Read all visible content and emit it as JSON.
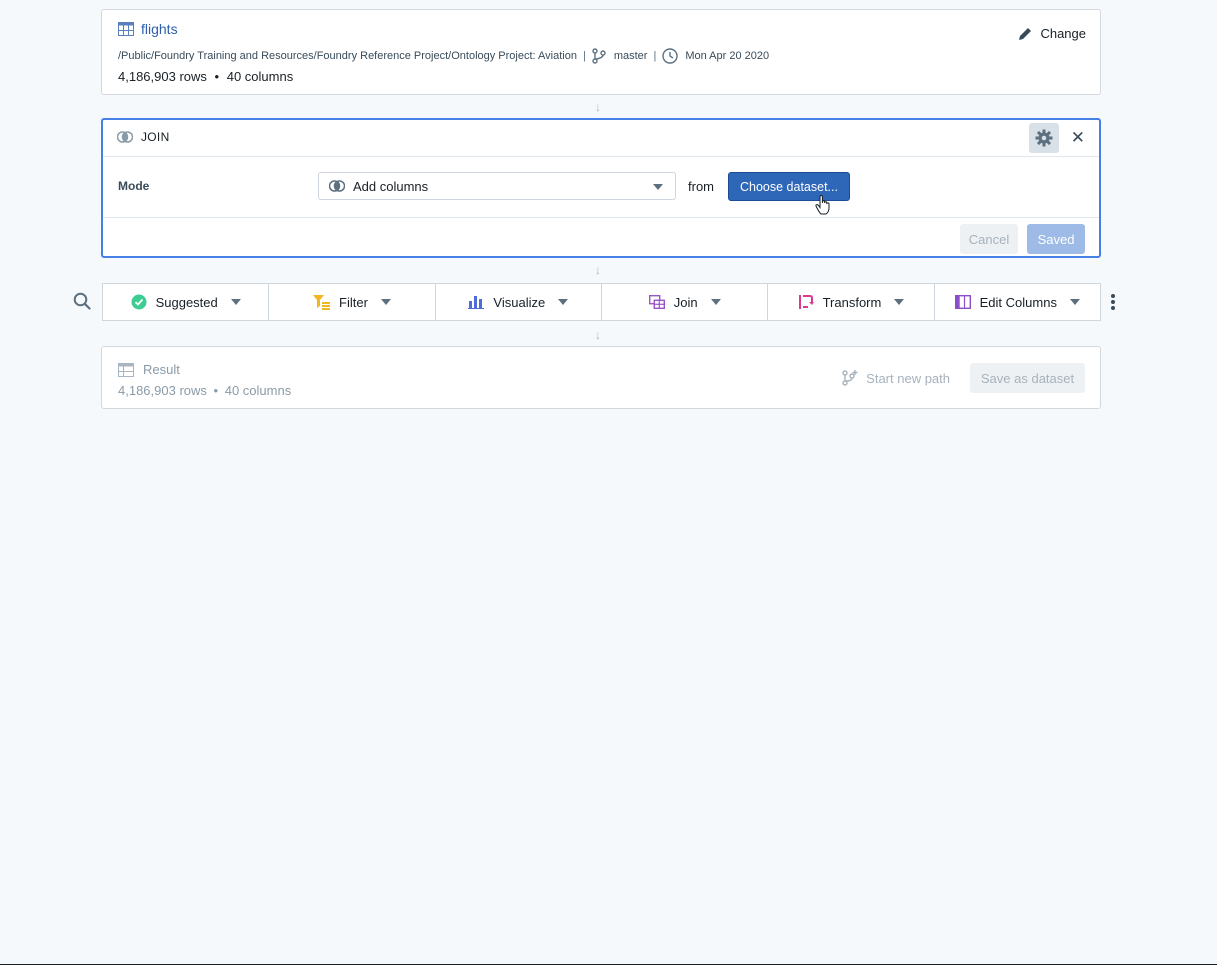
{
  "source": {
    "name": "flights",
    "path": "/Public/Foundry Training and Resources/Foundry Reference Project/Ontology Project: Aviation",
    "branch": "master",
    "date": "Mon Apr 20 2020",
    "rows": "4,186,903 rows",
    "columns": "40 columns",
    "change_label": "Change",
    "icons": {
      "dataset": "table-icon",
      "branch": "git-branch-icon",
      "time": "clock-icon",
      "edit": "pencil-icon"
    }
  },
  "join": {
    "title": "JOIN",
    "mode_label": "Mode",
    "mode_value": "Add columns",
    "from_label": "from",
    "choose_label": "Choose dataset...",
    "cancel_label": "Cancel",
    "saved_label": "Saved",
    "icons": {
      "join": "join-icon",
      "settings": "gear-icon",
      "close": "close-icon"
    }
  },
  "toolbar": {
    "items": [
      {
        "label": "Suggested",
        "icon": "check-circle-icon",
        "color": "#3dcc91"
      },
      {
        "label": "Filter",
        "icon": "filter-icon",
        "color": "#f2b824"
      },
      {
        "label": "Visualize",
        "icon": "bar-chart-icon",
        "color": "#4f6bd8"
      },
      {
        "label": "Join",
        "icon": "join-table-icon",
        "color": "#9a55c8"
      },
      {
        "label": "Transform",
        "icon": "transform-icon",
        "color": "#db3b8c"
      },
      {
        "label": "Edit Columns",
        "icon": "columns-icon",
        "color": "#8a4fc9"
      }
    ]
  },
  "result": {
    "title": "Result",
    "rows": "4,186,903 rows",
    "columns": "40 columns",
    "start_new_path_label": "Start new path",
    "save_label": "Save as dataset"
  },
  "colors": {
    "accent": "#2e66b8",
    "focus_border": "#4580e6",
    "background": "#f6f9fc"
  }
}
